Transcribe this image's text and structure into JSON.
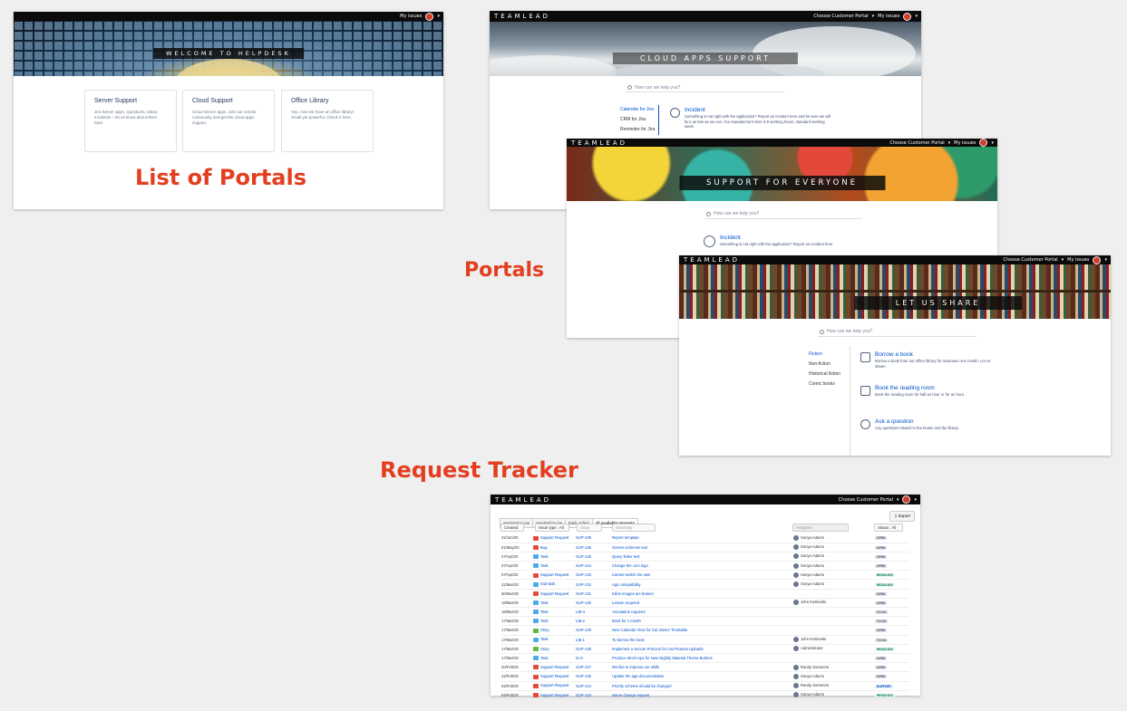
{
  "labels": {
    "list_of_portals": "List of Portals",
    "portals": "Portals",
    "request_tracker": "Request Tracker"
  },
  "colors": {
    "label": "#e33e1f",
    "link": "#0052cc",
    "topbar": "#0b0b0b"
  },
  "helpdesk": {
    "my_issues": "My issues",
    "hero_title": "WELCOME TO HELPDESK",
    "cards": [
      {
        "title": "Server Support",
        "desc": "Jira Server apps. Questions, Ideas, Incidents – let us know about them here."
      },
      {
        "title": "Cloud Support",
        "desc": "Cloud Server apps. Join our vendor community and get the cloud apps support."
      },
      {
        "title": "Office Library",
        "desc": "Yep, now we have an office library! Small yet powerful. Check it here."
      }
    ]
  },
  "cloud": {
    "brand": "TEAMLEAD",
    "choose_portal": "Choose Customer Portal",
    "my_issues": "My issues",
    "hero_title": "CLOUD APPS SUPPORT",
    "search_placeholder": "How can we help you?",
    "categories": [
      "Calendar for Jira",
      "CRM for Jira",
      "Reminder for Jira"
    ],
    "request": {
      "title": "Incident",
      "desc": "Something is not right with the application? Report an incident here and be sure we will fix it as fast as we can. Our standard turn-time is 8 working hours, standard working week."
    }
  },
  "everyone": {
    "brand": "TEAMLEAD",
    "choose_portal": "Choose Customer Portal",
    "my_issues": "My issues",
    "hero_title": "SUPPORT FOR EVERYONE",
    "search_placeholder": "How can we help you?",
    "request": {
      "title": "Incident",
      "desc": "Something is not right with the application? Report an incident here."
    }
  },
  "share": {
    "brand": "TEAMLEAD",
    "choose_portal": "Choose Customer Portal",
    "my_issues": "My issues",
    "hero_title": "LET US SHARE",
    "search_placeholder": "How can we help you?",
    "categories": [
      "Fiction",
      "Non-fiction",
      "Historical fiction",
      "Comic books"
    ],
    "requests": [
      {
        "title": "Borrow a book",
        "desc": "Borrow a book from our office library for maximum one month. Let us share!",
        "icon": "book-icon"
      },
      {
        "title": "Book the reading room",
        "desc": "Book the reading room for half an hour or for an hour.",
        "icon": "house-icon"
      },
      {
        "title": "Ask a question",
        "desc": "Any questions related to the books and the library.",
        "icon": "magnifier-icon"
      }
    ]
  },
  "tracker": {
    "brand": "TEAMLEAD",
    "choose_portal": "Choose Customer Portal",
    "tabs": [
      "assigned to me",
      "reported by me",
      "track orders",
      "all available requests"
    ],
    "export": "Export",
    "filters": {
      "created": "Created",
      "issue_type": "Issue type : All",
      "issue": "Issue",
      "summary": "Summary",
      "assignee": "Assignee",
      "status": "Status : All"
    },
    "rows": [
      {
        "date": "22/Jun/20",
        "type": "Support Request",
        "tc": "#e5493a",
        "key": "SUP-138",
        "summary": "Report template",
        "assignee": "Sonya Adams",
        "status": "OPEN",
        "sc": "#dfe1e6",
        "stc": "#42526e"
      },
      {
        "date": "01/May/20",
        "type": "Bug",
        "tc": "#e5493a",
        "key": "SUP-136",
        "summary": "Screen schemes test",
        "assignee": "Sonya Adams",
        "status": "OPEN",
        "sc": "#dfe1e6",
        "stc": "#42526e"
      },
      {
        "date": "27/Apr/20",
        "type": "Task",
        "tc": "#4bade8",
        "key": "SUP-135",
        "summary": "Query linker test",
        "assignee": "Sonya Adams",
        "status": "OPEN",
        "sc": "#dfe1e6",
        "stc": "#42526e"
      },
      {
        "date": "27/Apr/20",
        "type": "Task",
        "tc": "#4bade8",
        "key": "SUP-134",
        "summary": "Change the com logo",
        "assignee": "Sonya Adams",
        "status": "OPEN",
        "sc": "#dfe1e6",
        "stc": "#42526e"
      },
      {
        "date": "07/Apr/20",
        "type": "Support Request",
        "tc": "#e5493a",
        "key": "SUP-133",
        "summary": "Cannot switch the user",
        "assignee": "Sonya Adams",
        "status": "RESOLVED",
        "sc": "#e3fcef",
        "stc": "#006644"
      },
      {
        "date": "31/Mar/20",
        "type": "Sub-task",
        "tc": "#4bade8",
        "key": "SUP-132",
        "summary": "App compatibility",
        "assignee": "Sonya Adams",
        "status": "RESOLVED",
        "sc": "#e3fcef",
        "stc": "#006644"
      },
      {
        "date": "30/Mar/20",
        "type": "Support Request",
        "tc": "#e5493a",
        "key": "SUP-131",
        "summary": "Inline images are broken",
        "assignee": "",
        "status": "OPEN",
        "sc": "#dfe1e6",
        "stc": "#42526e"
      },
      {
        "date": "18/Mar/20",
        "type": "Task",
        "tc": "#4bade8",
        "key": "SUP-130",
        "summary": "Lesson required",
        "assignee": "John Koslovski",
        "status": "OPEN",
        "sc": "#dfe1e6",
        "stc": "#42526e"
      },
      {
        "date": "18/Mar/20",
        "type": "Task",
        "tc": "#4bade8",
        "key": "LIB-3",
        "summary": "Annotation required",
        "assignee": "",
        "status": "TO DO",
        "sc": "#dfe1e6",
        "stc": "#42526e"
      },
      {
        "date": "17/Mar/20",
        "type": "Task",
        "tc": "#4bade8",
        "key": "LIB-2",
        "summary": "Book for 1 month",
        "assignee": "",
        "status": "TO DO",
        "sc": "#dfe1e6",
        "stc": "#42526e"
      },
      {
        "date": "17/Mar/20",
        "type": "Story",
        "tc": "#63ba3c",
        "key": "SUP-129",
        "summary": "New Calendar View for Cat Owner Timetable",
        "assignee": "",
        "status": "OPEN",
        "sc": "#dfe1e6",
        "stc": "#42526e"
      },
      {
        "date": "17/Mar/20",
        "type": "Task",
        "tc": "#4bade8",
        "key": "LIB-1",
        "summary": "To borrow the book",
        "assignee": "John Koslovski",
        "status": "TO DO",
        "sc": "#dfe1e6",
        "stc": "#42526e"
      },
      {
        "date": "17/Mar/20",
        "type": "Story",
        "tc": "#63ba3c",
        "key": "SUP-128",
        "summary": "Implement a Secure Protocol for Cat Pictures Uploads",
        "assignee": "Administrator",
        "status": "RESOLVED",
        "sc": "#e3fcef",
        "stc": "#006644"
      },
      {
        "date": "17/Mar/20",
        "type": "Task",
        "tc": "#4bade8",
        "key": "IS-9",
        "summary": "Produce Mock-Ups for New Nightly Material Theme Buttons",
        "assignee": "",
        "status": "OPEN",
        "sc": "#dfe1e6",
        "stc": "#42526e"
      },
      {
        "date": "20/Feb/20",
        "type": "Support Request",
        "tc": "#e5493a",
        "key": "SUP-127",
        "summary": "We like to improve our skills",
        "assignee": "Randy Summers",
        "status": "OPEN",
        "sc": "#dfe1e6",
        "stc": "#42526e"
      },
      {
        "date": "12/Feb/20",
        "type": "Support Request",
        "tc": "#e5493a",
        "key": "SUP-125",
        "summary": "Update the app documentation",
        "assignee": "Sonya Adams",
        "status": "OPEN",
        "sc": "#dfe1e6",
        "stc": "#42526e"
      },
      {
        "date": "04/Feb/20",
        "type": "Support Request",
        "tc": "#e5493a",
        "key": "SUP-124",
        "summary": "Priority scheme should be changed",
        "assignee": "Randy Summers",
        "status": "SUPPORT",
        "sc": "#deebff",
        "stc": "#0747a6"
      },
      {
        "date": "04/Feb/20",
        "type": "Support Request",
        "tc": "#e5493a",
        "key": "SUP-123",
        "summary": "Name change request",
        "assignee": "Sonya Adams",
        "status": "RESOLVED",
        "sc": "#e3fcef",
        "stc": "#006644"
      }
    ]
  }
}
